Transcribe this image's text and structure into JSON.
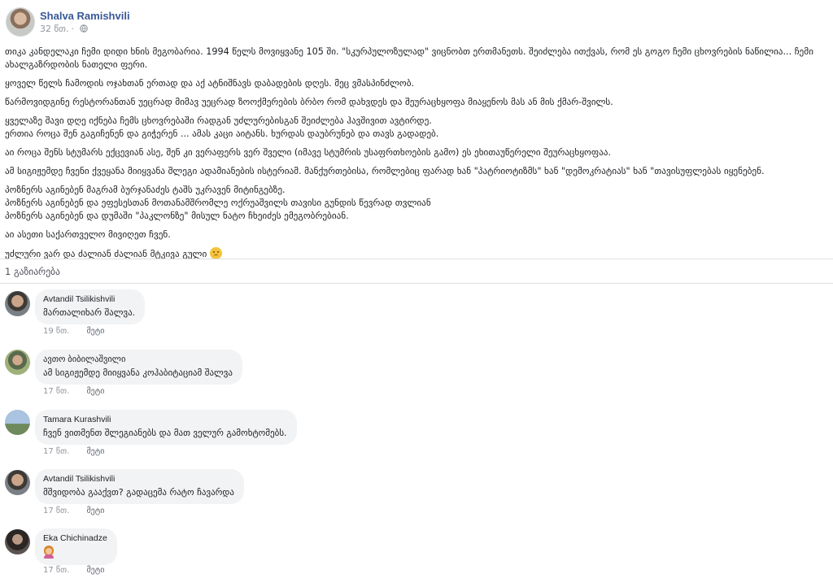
{
  "post": {
    "author": "Shalva Ramishvili",
    "time": "32 წთ.",
    "paragraphs": [
      "თიკა კანდელაკი ჩემი დიდი ხნის მეგობარია. 1994 წელს მოვიყვანე 105 ში. \"სკურპულოზულად\" ვიცნობთ ერთმანეთს. შეიძლება ითქვას, რომ ეს გოგო ჩემი ცხოვრების ნაწილია... ჩემი ახალგაზრდობის ნათელი ფერი.",
      "ყოველ წელს ჩამოდის ოჯახთან ერთად და აქ ატნიშნავს დაბადების დღეს. მეც ვმასპინძლობ.",
      "წარმოვიდგინე რესტორანთან უეცრად მიმავ უეცრად ზოოქმერების ბრბო რომ დახვდეს და შეურაცხყოფა მიაყენოს მას ან მის ქმარ-შვილს.",
      "ყველაზე შავი დღე იქნება ჩემს ცხოვრებაში რადგან უძლურებისგან შეიძლება ჰავშივით ავტირდე.\nერთია როცა შენ გაგიჩენენ და გიჭერენ ... ამას კაცი აიტანს. ხურდას დაუბრუნებ და თავს გადადებ.",
      "აი როცა შენს სტუმარს ექცევიან ასე, შენ კი ვერაფერს ვერ შველი (იმავე სტუმრის უსაფრთხოების გამო) ეს ეხითაუწერელი შეურაცხყოფაა.",
      "ამ სიგიჟემდე ჩვენი ქვეყანა მიიყვანა შლეგი ადამიანების ისტერიამ. მანქურთებისა, რომლებიც ფარად ხან \"პატრიოტიზმს\" ხან \"დემოკრატიას\" ხან \"თავისუფლებას იყენებენ.",
      "პოზნერს აგინებენ მაგრამ ბურჯანაძეს ტაშს უკრავენ მიტინგებზე.\nპოზნერს აგინებენ და ეფესესთან მოთანამშრომლე ოქრუაშვილს თავისი გუნდის წევრად თვლიან\nპოზნერს აგინებენ და დუმაში \"პაკლონზე\" მისულ ნატო ჩხეიძეს ემეგობრებიან.",
      "აი ასეთი საქართველო მივიღეთ ჩვენ.",
      "უძლური ვარ და ძალიან ძალიან მტკივა გული"
    ],
    "shares": "1 გაზიარება"
  },
  "comments": [
    {
      "author": "Avtandil Tsilikishvili",
      "text": "მართალიხარ შალვა.",
      "time": "19 წთ.",
      "more": "მეტი"
    },
    {
      "author": "ავთო ბიბილაშვილი",
      "text": "ამ სიგიჟემდე მიიყვანა კოჰაბიტაციამ შალვა",
      "time": "17 წთ.",
      "more": "მეტი"
    },
    {
      "author": "Tamara Kurashvili",
      "text": "ჩვენ ვითმენთ შლეგიანებს და მათ ველურ გამოხტომებს.",
      "time": "17 წთ.",
      "more": "მეტი"
    },
    {
      "author": "Avtandil Tsilikishvili",
      "text": "მშვიდობა გააქვთ? გადაცემა რატო ჩავარდა",
      "time": "17 წთ.",
      "more": "მეტი"
    },
    {
      "author": "Eka Chichinadze",
      "text": "",
      "time": "17 წთ.",
      "more": "მეტი"
    }
  ],
  "icons": {
    "post_privacy": "globe-icon",
    "last_paragraph_emoji": "disappointed-face-emoji",
    "comment5_emoji": "woman-tipping-hand-emoji"
  },
  "colors": {
    "author_link": "#385898",
    "meta_gray": "#90949c",
    "bubble_bg": "#f2f3f5"
  }
}
